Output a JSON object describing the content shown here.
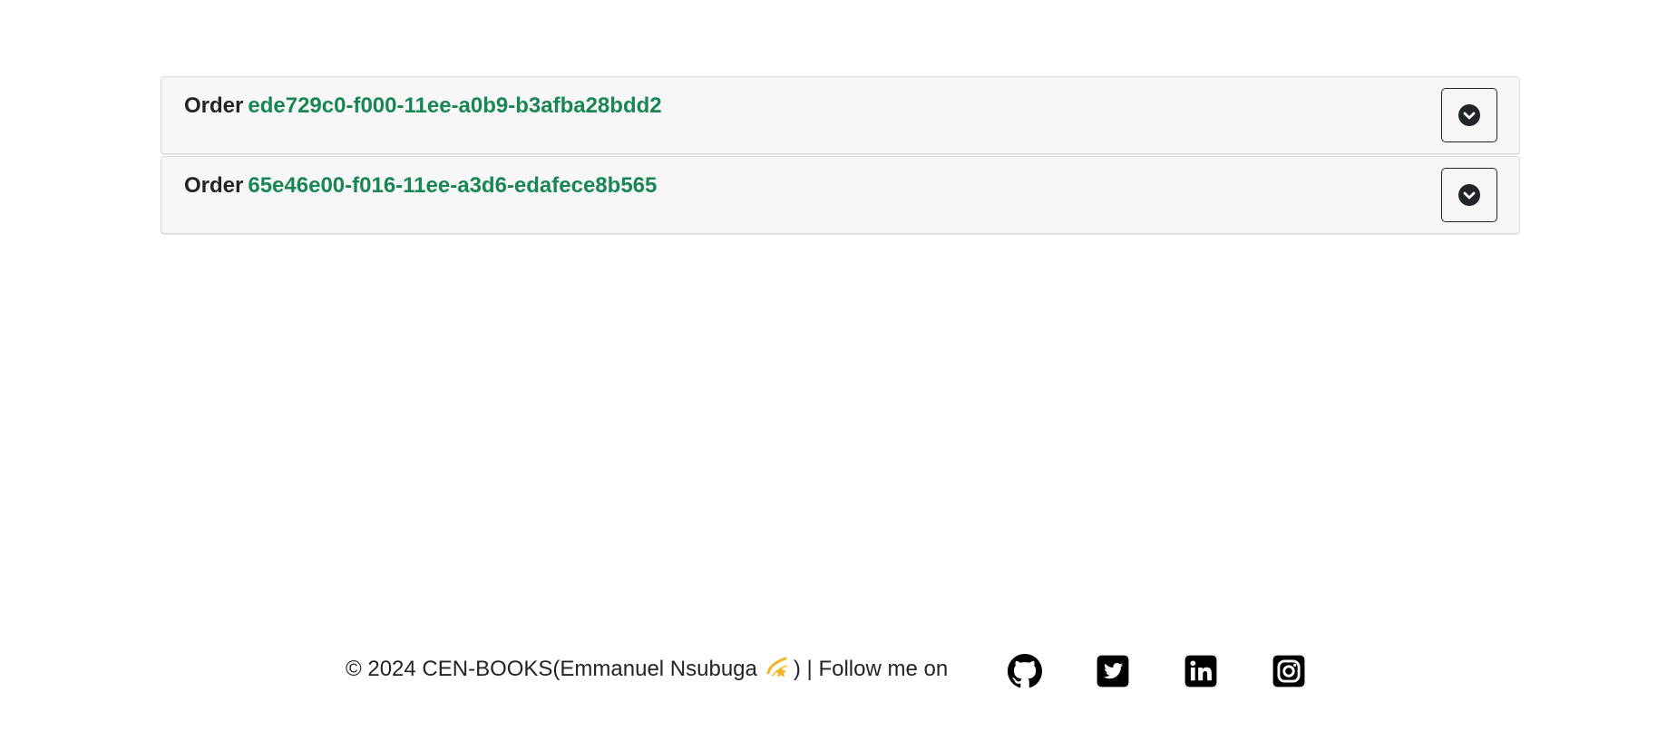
{
  "orders": [
    {
      "label": "Order",
      "id": "ede729c0-f000-11ee-a0b9-b3afba28bdd2",
      "toggle_icon": "chevron-down-circle-icon"
    },
    {
      "label": "Order",
      "id": "65e46e00-f016-11ee-a3d6-edafece8b565",
      "toggle_icon": "chevron-down-circle-icon"
    }
  ],
  "footer": {
    "prefix": "© 2024 CEN-BOOKS(Emmanuel Nsubuga",
    "emoji_icon": "dizzy-star-emoji",
    "suffix": ") | Follow me on",
    "social": [
      {
        "icon": "github-icon"
      },
      {
        "icon": "twitter-icon"
      },
      {
        "icon": "linkedin-icon"
      },
      {
        "icon": "instagram-icon"
      }
    ]
  },
  "colors": {
    "order_id": "#198754",
    "text": "#212529",
    "card_bg": "#f7f7f7",
    "emoji": "#f0b429"
  }
}
